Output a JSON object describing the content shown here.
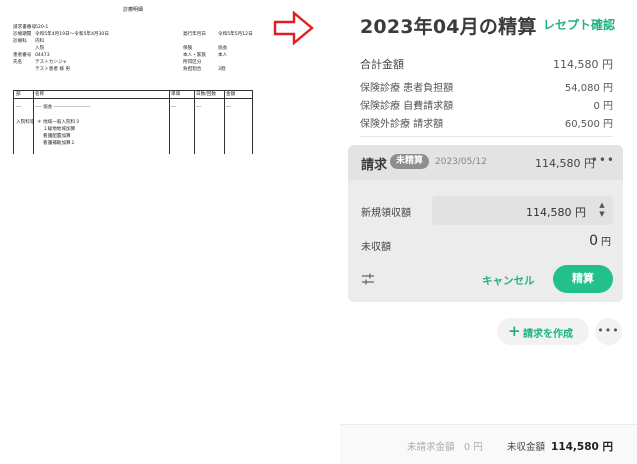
{
  "document": {
    "title": "診療明細",
    "rows": [
      {
        "k": "請求書番号",
        "v": "520-1"
      },
      {
        "k": "診療期間",
        "v": "令和5年4月19日～令和5年4月30日",
        "k2": "発行年月日",
        "v2": "令和5年5月12日"
      },
      {
        "k": "診療科",
        "v": "内科"
      },
      {
        "k": "",
        "v": "入院",
        "k2": "保険",
        "v2": "協会"
      },
      {
        "k": "患者番号",
        "v": "04473",
        "k2": "本人・家族",
        "v2": "本人"
      },
      {
        "k": "氏名",
        "v": "テストカンジャ",
        "k2": "所得区分",
        "v2": ""
      },
      {
        "k": "",
        "v": "テスト患者 様 男",
        "k2": "負担割合",
        "v2": "3割"
      }
    ],
    "table_headers": [
      "部",
      "名称",
      "単価",
      "日数/回数",
      "金額"
    ],
    "table_rows": [
      {
        "c0": "---",
        "c1": "---- 協会 ----------------------",
        "c2": "---",
        "c3": "---",
        "c4": "---"
      },
      {
        "c0": "入院料等",
        "c1": "＊ 地域一般入院料３"
      },
      {
        "c0": "",
        "c1": "１級地地域加算"
      },
      {
        "c0": "",
        "c1": "看護配置加算"
      },
      {
        "c0": "",
        "c1": "看護補助加算１"
      }
    ]
  },
  "panel": {
    "title": "2023年04月の精算",
    "receipt_link": "レセプト確認",
    "summary": [
      {
        "label": "合計金額",
        "value": "114,580 円"
      },
      {
        "label": "保険診療 患者負担額",
        "value": "54,080 円"
      },
      {
        "label": "保険診療 自費請求額",
        "value": "0 円"
      },
      {
        "label": "保険外診療 請求額",
        "value": "60,500 円"
      }
    ],
    "invoice": {
      "title": "請求",
      "badge": "未精算",
      "date": "2023/05/12",
      "amount": "114,580 円",
      "more": "•••",
      "new_receipt_label": "新規領収額",
      "new_receipt_value": "114,580 円",
      "unpaid_label": "未収額",
      "unpaid_value": "0",
      "unpaid_unit": "円",
      "cancel_label": "キャンセル",
      "settle_label": "精算"
    },
    "create_invoice_label": "請求を作成",
    "more_label": "•••",
    "footer": {
      "unbilled": "未請求金額　0 円",
      "unpaid_label": "未収金額",
      "unpaid_value": "114,580 円"
    }
  },
  "colors": {
    "accent": "#22b27f",
    "settle_button": "#22c08a",
    "arrow": "#e02020",
    "badge": "#8e8e8e"
  },
  "icons": [
    "arrow-right-icon",
    "settings-sliders-icon",
    "plus-icon",
    "more-icon",
    "spinner-icon"
  ]
}
